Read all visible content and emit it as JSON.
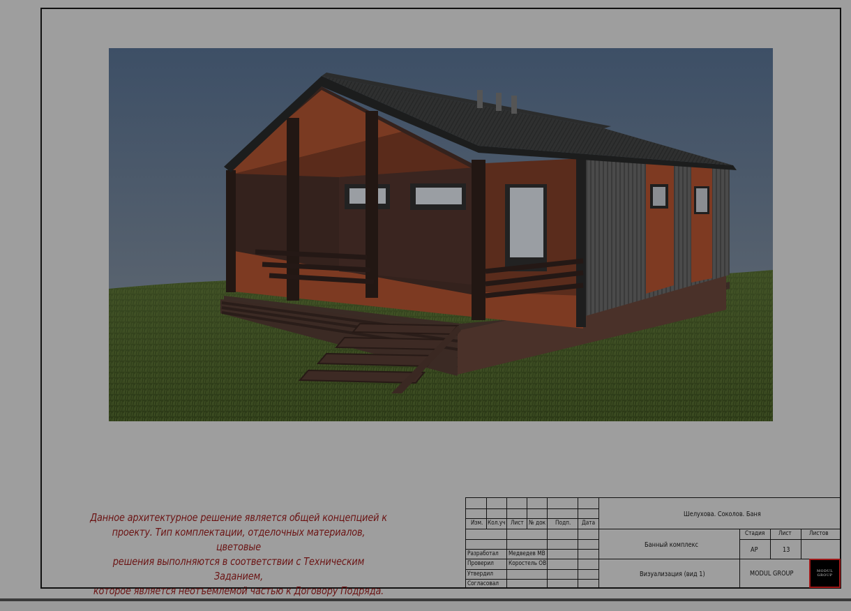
{
  "note": {
    "lines": [
      "Данное архитектурное решение является общей концепцией к",
      "проекту. Тип комплектации, отделочных материалов, цветовые",
      "решения выполняются в соответствии с Техническим Заданием,",
      "которое является неотъемлемой частью к Договору Подряда."
    ]
  },
  "title_block": {
    "headers": [
      "Изм.",
      "Кол.уч",
      "Лист",
      "№ док",
      "Подп.",
      "Дата"
    ],
    "project_name": "Шелухова. Соколов. Баня",
    "object_name": "Банный комплекс",
    "sheet_title": "Визуализация (вид 1)",
    "stage_label": "Стадия",
    "sheet_label": "Лист",
    "sheets_label": "Листов",
    "stage_value": "АР",
    "sheet_value": "13",
    "company": "MODUL GROUP",
    "logo_text": "MODUL GROUP",
    "roles": [
      {
        "role": "Разработал",
        "name": "Медведев МВ"
      },
      {
        "role": "Проверил",
        "name": "Коростель ОВ"
      },
      {
        "role": "Утвердил",
        "name": ""
      },
      {
        "role": "Согласовал",
        "name": ""
      }
    ]
  },
  "colors": {
    "note_text": "#6b1414",
    "frame": "#111111",
    "logo_border": "#a01818"
  }
}
